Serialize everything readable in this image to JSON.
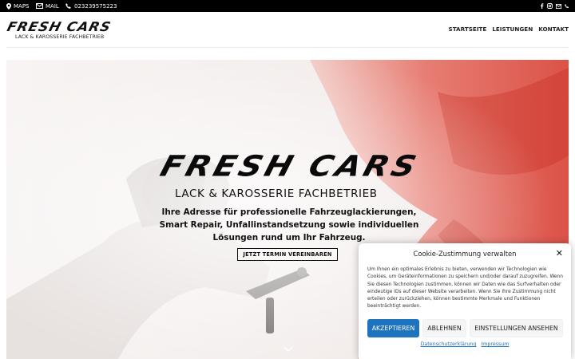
{
  "topbar": {
    "maps_label": "MAPS",
    "mail_label": "MAIL",
    "phone_label": "023239575223",
    "social_icons": [
      "facebook-icon",
      "instagram-icon",
      "mail-icon",
      "phone-icon"
    ]
  },
  "header": {
    "logo_word": "FRESH CARS",
    "logo_subtitle": "LACK & KAROSSERIE FACHBETRIEB",
    "nav": [
      "STARTSEITE",
      "LEISTUNGEN",
      "KONTAKT"
    ]
  },
  "hero": {
    "logo_word": "FRESH CARS",
    "subtitle": "LACK & KAROSSERIE FACHBETRIEB",
    "text": "Ihre Adresse für professionelle Fahrzeuglackierungen, Smart Repair, Unfallinstandsetzung sowie individuellen Lösungen rund um Ihr Fahrzeug.",
    "cta_label": "JETZT TERMIN VEREINBAREN"
  },
  "cookie": {
    "title": "Cookie-Zustimmung verwalten",
    "close_symbol": "✕",
    "text": "Um Ihnen ein optimales Erlebnis zu bieten, verwenden wir Technologien wie Cookies, um Geräteinformationen zu speichern und/oder darauf zuzugreifen. Wenn Sie diesen Technologien zustimmen, können wir Daten wie das Surfverhalten oder eindeutige IDs auf dieser Website verarbeiten. Wenn Sie Ihre Zustimmung nicht erteilen oder zurückziehen, können bestimmte Merkmale und Funktionen beeinträchtigt werden.",
    "accept_label": "AKZEPTIEREN",
    "deny_label": "ABLEHNEN",
    "settings_label": "EINSTELLUNGEN ANSEHEN",
    "privacy_link": "Datenschutzerklärung",
    "imprint_link": "Impressum"
  },
  "colors": {
    "accent": "#1e73be",
    "topbar_bg": "#000000",
    "car_red": "#e03a2f"
  }
}
